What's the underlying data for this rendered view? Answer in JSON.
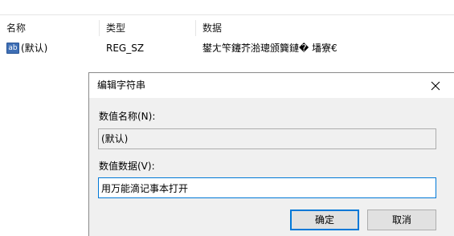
{
  "list": {
    "columns": {
      "name": "名称",
      "type": "类型",
      "data": "数据"
    },
    "rows": [
      {
        "icon": "registry-string-icon",
        "icon_text": "ab",
        "name": "(默认)",
        "type": "REG_SZ",
        "data": "鐢ㄤ笇鑳芥湁璁颁簨鏈�  墦寮€"
      }
    ]
  },
  "dialog": {
    "title": "编辑字符串",
    "value_name_label": "数值名称(N):",
    "value_name": "(默认)",
    "value_data_label": "数值数据(V):",
    "value_data": "用万能滴记事本打开",
    "ok_label": "确定",
    "cancel_label": "取消"
  },
  "colors": {
    "accent": "#0078d7",
    "dialog_bg": "#f0f0f0",
    "button_bg": "#e1e1e1"
  }
}
